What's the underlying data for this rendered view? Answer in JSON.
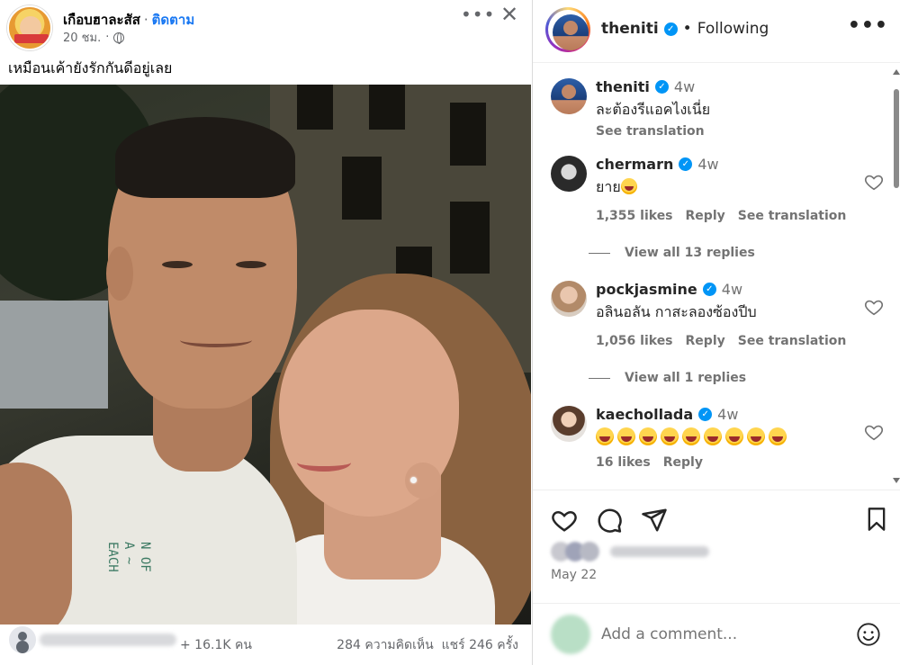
{
  "facebook": {
    "page_name": "เกือบฮาละสัส",
    "separator": "·",
    "follow_label": "ติดตาม",
    "post_time": "20 ชม.",
    "time_separator": "·",
    "caption": "เหมือนเค้ายังรักกันดีอยู่เลย",
    "more_icon": "ellipsis-icon",
    "close_icon": "close-icon",
    "shirt_print": "N OF\nA ~\nEACH",
    "reactions_text": "+ 16.1K คน",
    "comments_count": "284 ความคิดเห็น",
    "shares_count": "แชร์ 246 ครั้ง"
  },
  "instagram": {
    "username": "theniti",
    "header_separator": "•",
    "following_label": "Following",
    "verified_glyph": "✓",
    "comments": [
      {
        "username": "theniti",
        "time": "4w",
        "text": "ละต้องรีแอคไงเนี่ย",
        "see_translation": "See translation"
      },
      {
        "username": "chermarn",
        "time": "4w",
        "text": "ยาย",
        "likes": "1,355 likes",
        "reply": "Reply",
        "see_translation": "See translation",
        "view_replies": "View all 13 replies"
      },
      {
        "username": "pockjasmine",
        "time": "4w",
        "text": "อลินอลัน กาสะลองซ้องปีบ",
        "likes": "1,056 likes",
        "reply": "Reply",
        "see_translation": "See translation",
        "view_replies": "View all 1 replies"
      },
      {
        "username": "kaechollada",
        "time": "4w",
        "emoji_count": 9,
        "likes": "16 likes",
        "reply": "Reply"
      }
    ],
    "date": "May 22",
    "comment_placeholder": "Add a comment...",
    "colors": {
      "verified": "#0095f6",
      "muted_text": "#737373",
      "fb_link": "#1877f2"
    }
  }
}
